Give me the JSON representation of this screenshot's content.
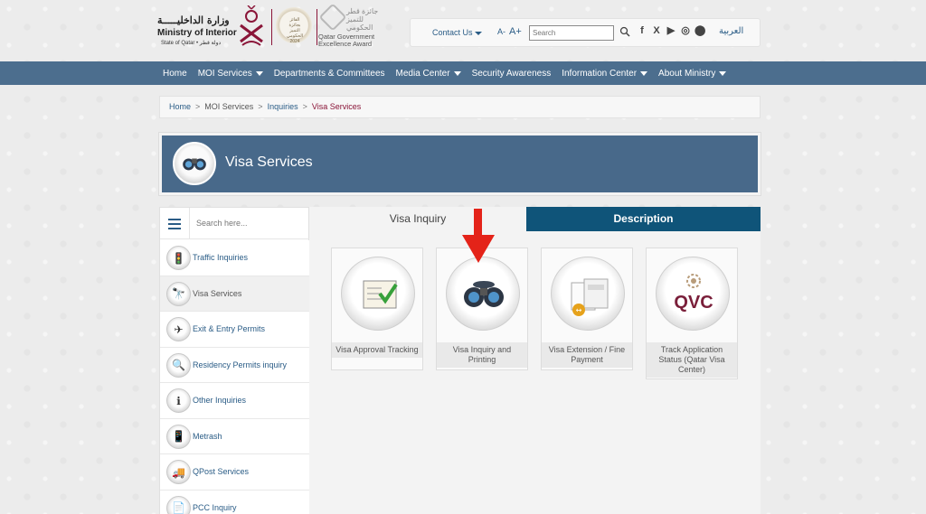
{
  "header": {
    "ministry_name_ar": "وزارة الداخليـــــة",
    "ministry_name_en": "Ministry of Interior",
    "ministry_sub": "State of Qatar • دولة قطر",
    "seal_text": "الفائز بجائزة التميز الحكومي 2024",
    "award_ar": "جائزة قطر للتميز الحكومي",
    "award_en": "Qatar Government Excellence Award",
    "contact_label": "Contact Us",
    "font_small": "A-",
    "font_large": "A+",
    "search_placeholder": "Search",
    "social": [
      "f",
      "X",
      "▶",
      "◎",
      "⬤"
    ],
    "language": "العربية"
  },
  "nav": {
    "items": [
      {
        "label": "Home",
        "dropdown": false
      },
      {
        "label": "MOI Services",
        "dropdown": true
      },
      {
        "label": "Departments & Committees",
        "dropdown": false
      },
      {
        "label": "Media Center",
        "dropdown": true
      },
      {
        "label": "Security Awareness",
        "dropdown": false
      },
      {
        "label": "Information Center",
        "dropdown": true
      },
      {
        "label": "About Ministry",
        "dropdown": true
      }
    ]
  },
  "breadcrumb": {
    "home": "Home",
    "moi_services": "MOI Services",
    "inquiries": "Inquiries",
    "current": "Visa Services",
    "separator": ">"
  },
  "page": {
    "title": "Visa Services"
  },
  "sidebar": {
    "search_placeholder": "Search here...",
    "items": [
      {
        "label": "Traffic Inquiries",
        "icon": "traffic-light-icon",
        "glyph": "🚦",
        "active": false
      },
      {
        "label": "Visa Services",
        "icon": "binoculars-icon",
        "glyph": "🔭",
        "active": true
      },
      {
        "label": "Exit & Entry Permits",
        "icon": "plane-icon",
        "glyph": "✈",
        "active": false
      },
      {
        "label": "Residency Permits inquiry",
        "icon": "magnifier-card-icon",
        "glyph": "🔍",
        "active": false
      },
      {
        "label": "Other Inquiries",
        "icon": "info-icon",
        "glyph": "ℹ",
        "active": false
      },
      {
        "label": "Metrash",
        "icon": "phone-icon",
        "glyph": "📱",
        "active": false
      },
      {
        "label": "QPost Services",
        "icon": "truck-icon",
        "glyph": "🚚",
        "active": false
      },
      {
        "label": "PCC Inquiry",
        "icon": "certificate-icon",
        "glyph": "📄",
        "active": false
      }
    ]
  },
  "tabs": {
    "active": "Visa Inquiry",
    "inactive": "Description"
  },
  "cards": [
    {
      "label": "Visa Approval Tracking",
      "icon": "checklist-icon"
    },
    {
      "label": "Visa Inquiry and Printing",
      "icon": "binoculars-icon"
    },
    {
      "label": "Visa Extension / Fine Payment",
      "icon": "document-payment-icon"
    },
    {
      "label": "Track Application Status (Qatar Visa Center)",
      "icon": "qvc-logo-icon",
      "logo_text": "QVC"
    }
  ],
  "colors": {
    "nav_bg": "#4c6e8e",
    "banner_bg": "#48698a",
    "tab_active_bg": "#0f5479",
    "link": "#2a5c86",
    "maroon": "#8a1538",
    "arrow": "#e42319"
  }
}
